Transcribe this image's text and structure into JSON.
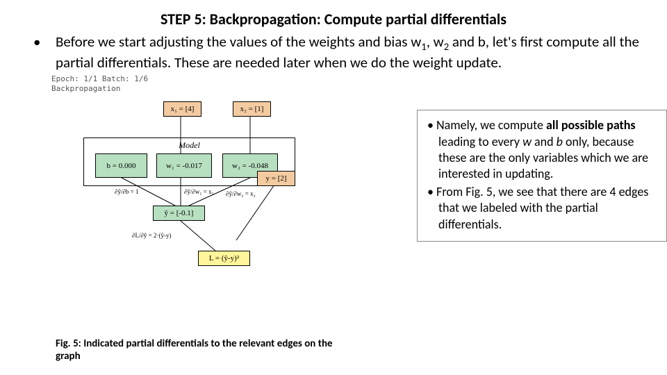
{
  "title": "STEP 5: Backpropagation: Compute partial differentials",
  "intro_prefix": "Before we start adjusting the values of the weights and bias w",
  "intro_mid1": ", w",
  "intro_suffix": " and b, let's first compute all the partial differentials. These are needed later when we do the weight update.",
  "terminal": {
    "line1": "Epoch: 1/1 Batch: 1/6",
    "line2": "Backpropagation"
  },
  "graph": {
    "model_label": "Model",
    "nodes": {
      "x1": "x₁ = [4]",
      "x2": "x₂ = [1]",
      "b": "b = 0.000",
      "w1": "w₁ = -0.017",
      "w2": "w₂ = -0.048",
      "yhat": "ŷ = [-0.1]",
      "y": "y = [2]",
      "L": "L = (ŷ-y)²"
    },
    "edges": {
      "db": "∂ŷ/∂b = 1",
      "dw1": "∂ŷ/∂w₁ = x₁",
      "dw2": "∂ŷ/∂w₂ = x₂",
      "dL": "∂L/∂ŷ = 2·(ŷ-y)"
    }
  },
  "caption": "Fig. 5: Indicated partial differentials to the relevant edges on the graph",
  "side": {
    "b1_a": "Namely, we compute ",
    "b1_bold": "all possible paths",
    "b1_b": " leading to every ",
    "b1_w": "w",
    "b1_and": " and ",
    "b1_bb": "b",
    "b1_c": " only, because these are the only variables which we are interested in updating.",
    "b2": "From Fig. 5, we see that there are 4 edges that we labeled with the partial differentials."
  }
}
